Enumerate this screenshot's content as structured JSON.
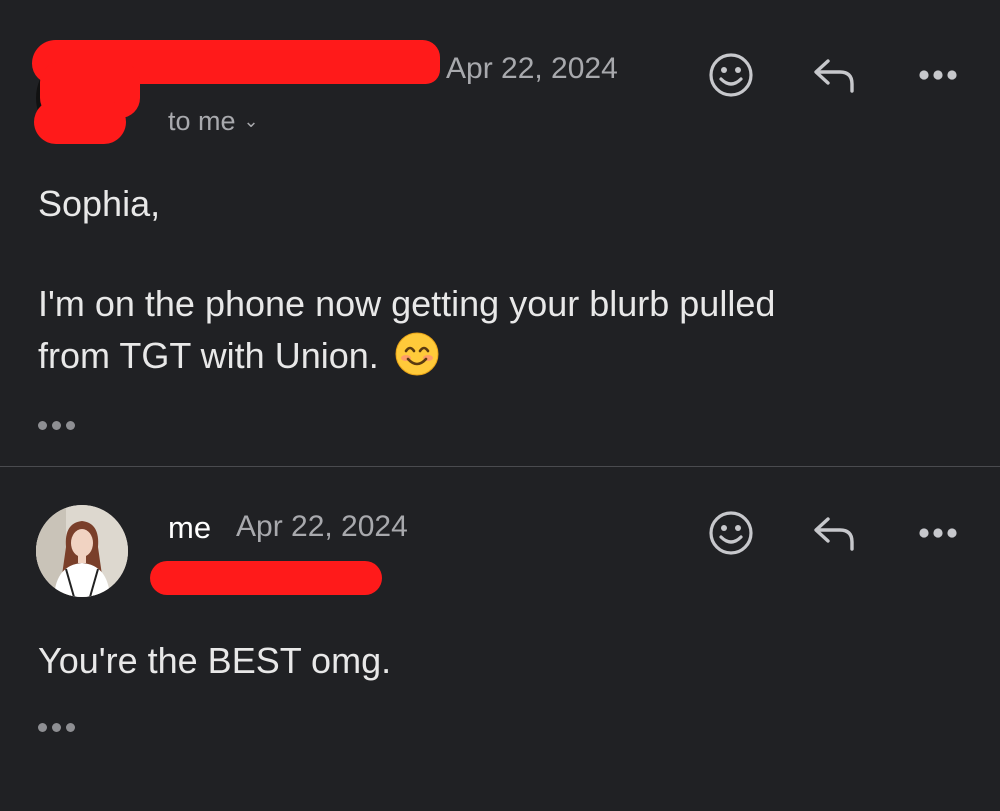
{
  "messages": [
    {
      "date": "Apr 22, 2024",
      "recipient": "to me",
      "greeting": "Sophia,",
      "body_line1": "I'm on the phone now getting your blurb pulled",
      "body_line2": "from TGT with Union.",
      "emoji": "smiling-face-with-smiling-eyes"
    },
    {
      "sender": "me",
      "date": "Apr 22, 2024",
      "body": "You're the BEST omg."
    }
  ],
  "icons": {
    "react": "smiley-icon",
    "reply": "reply-arrow-icon",
    "more": "more-horizontal-icon"
  },
  "colors": {
    "background": "#202124",
    "redaction": "#ff1a1a",
    "text": "#e8e8e8",
    "muted": "#a8a9ad"
  }
}
